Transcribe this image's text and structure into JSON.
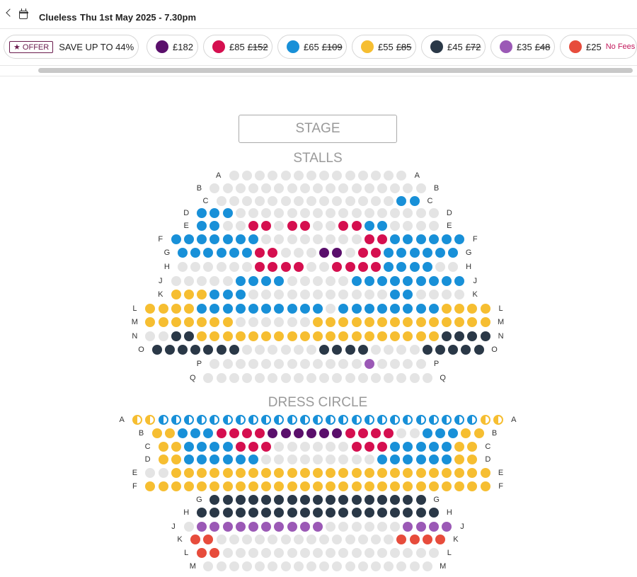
{
  "header": {
    "title": "Clueless",
    "date": "Thu 1st May 2025 - 7.30pm"
  },
  "offer": {
    "tag": "★ OFFER",
    "text": "SAVE UP TO 44%"
  },
  "price_bands": [
    {
      "key": "p",
      "price": "£182",
      "old": "",
      "note": "",
      "color": "#5a0f6b"
    },
    {
      "key": "r",
      "price": "£85",
      "old": "£152",
      "note": "",
      "color": "#d50f4f"
    },
    {
      "key": "b",
      "price": "£65",
      "old": "£109",
      "note": "",
      "color": "#1890d8"
    },
    {
      "key": "y",
      "price": "£55",
      "old": "£85",
      "note": "",
      "color": "#f6be31"
    },
    {
      "key": "n",
      "price": "£45",
      "old": "£72",
      "note": "",
      "color": "#2a3847"
    },
    {
      "key": "l",
      "price": "£35",
      "old": "£48",
      "note": "",
      "color": "#9b59b6"
    },
    {
      "key": "o",
      "price": "£25",
      "old": "",
      "note": "No Fees",
      "color": "#e74c3c"
    }
  ],
  "unavailable_color": "#e4e4e4",
  "stage_label": "STAGE",
  "stalls": {
    "label": "STALLS",
    "rows": [
      {
        "id": "A",
        "seats": "gggggggggggggg"
      },
      {
        "id": "B",
        "seats": "ggggggggggggggggg"
      },
      {
        "id": "C",
        "seats": "ggggggggggggggbb"
      },
      {
        "id": "D",
        "seats": "bbbgggggggggggggggg"
      },
      {
        "id": "E",
        "seats": "bbggrrgrrggrrbbgggg"
      },
      {
        "id": "F",
        "seats": "bbbbbbbggggggggrrbbbbbb"
      },
      {
        "id": "G",
        "seats": "bbbbbbrrgggppgrrbbbbbb"
      },
      {
        "id": "H",
        "seats": "ggggggrrrrggrrrrbbbbgg"
      },
      {
        "id": "J",
        "seats": "gggggbbbbgggggbbbbbbbbb"
      },
      {
        "id": "K",
        "seats": "yyybbbgggggggggggbbgggg"
      },
      {
        "id": "L",
        "seats": "yyyybbbbbbbbbbgbbbbbbbbyyyy"
      },
      {
        "id": "M",
        "seats": "yyyyyyyggggggyyyyyyyyyyyyyy"
      },
      {
        "id": "N",
        "seats": "ggnnyyyyyyyyyyyyyyyyyyynnnn"
      },
      {
        "id": "O",
        "seats": "nnnnnnnggggggnnnnggggnnnnn"
      },
      {
        "id": "P",
        "seats": "gggggggggggglgggg"
      },
      {
        "id": "Q",
        "seats": "gggggggggggggggggg"
      }
    ]
  },
  "dress_circle": {
    "label": "DRESS CIRCLE",
    "rows": [
      {
        "id": "A",
        "seats": "YYBBBBBBBBBBBBBBBBBBBBBBBBBYY"
      },
      {
        "id": "B",
        "seats": "yybbbrrrrpppppprrrrggbbbyy"
      },
      {
        "id": "C",
        "seats": "yybbbbrrrggggggrrrbbbbbyy"
      },
      {
        "id": "D",
        "seats": "yybbbbbbgggggggggbbbbbbyy"
      },
      {
        "id": "E",
        "seats": "ggyyyyyyyyyyyyyyyyyyyyyyyyy"
      },
      {
        "id": "F",
        "seats": "yyyyyyyyyyyyyyyyyyyyyyyyyyy"
      },
      {
        "id": "G",
        "seats": "nnnnnnnnnnnnnnnnn"
      },
      {
        "id": "H",
        "seats": "nnnnnnnnnnnnnnnnnnn"
      },
      {
        "id": "J",
        "seats": "gllllllllllggggggllll"
      },
      {
        "id": "K",
        "seats": "ooggggggggggggggoooo"
      },
      {
        "id": "L",
        "seats": "ooggggggggggggggggg"
      },
      {
        "id": "M",
        "seats": "gggggggggggggggggg"
      }
    ]
  }
}
